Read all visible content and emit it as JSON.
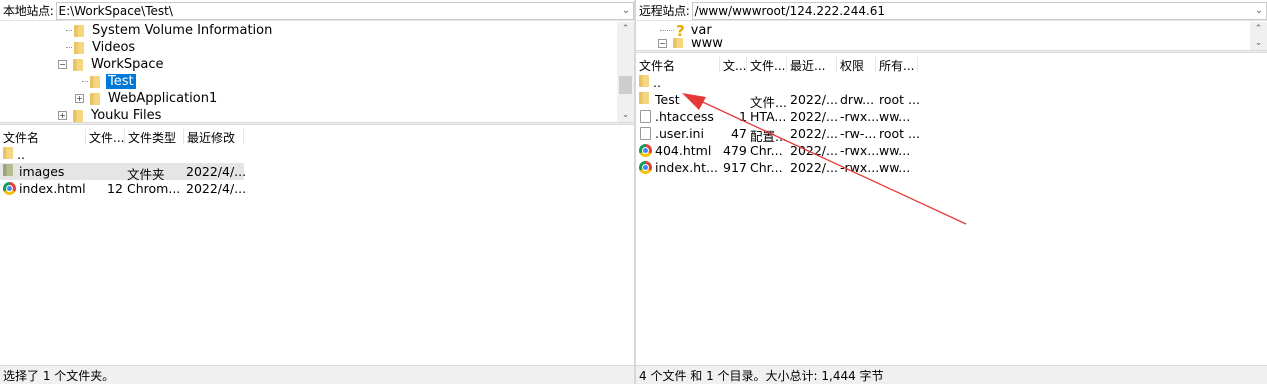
{
  "local": {
    "site_label": "本地站点:",
    "path": "E:\\WorkSpace\\Test\\",
    "tree": [
      {
        "label": "System Volume Information"
      },
      {
        "label": "Videos"
      },
      {
        "label": "WorkSpace",
        "expander": "−"
      },
      {
        "label": "Test",
        "selected": true
      },
      {
        "label": "WebApplication1",
        "expander": "+"
      },
      {
        "label": "Youku Files",
        "expander": "+"
      }
    ],
    "columns": [
      "文件名",
      "文件...",
      "文件类型",
      "最近修改"
    ],
    "files": [
      {
        "name": "..",
        "size": "",
        "type": "",
        "modified": "",
        "icon": "folder-icon"
      },
      {
        "name": "images",
        "size": "",
        "type": "文件夹",
        "modified": "2022/4/...",
        "icon": "folder-icon"
      },
      {
        "name": "index.html",
        "size": "12",
        "type": "Chrom...",
        "modified": "2022/4/...",
        "icon": "chrome-icon"
      }
    ],
    "status": "选择了 1 个文件夹。"
  },
  "remote": {
    "site_label": "远程站点:",
    "path": "/www/wwwroot/124.222.244.61",
    "tree": [
      {
        "label": "var",
        "icon": "question-icon"
      },
      {
        "label": "www",
        "expander": "−"
      }
    ],
    "columns": [
      "文件名",
      "文...",
      "文件...",
      "最近...",
      "权限",
      "所有..."
    ],
    "files": [
      {
        "name": "..",
        "size": "",
        "type": "",
        "modified": "",
        "perm": "",
        "owner": "",
        "icon": "folder-icon"
      },
      {
        "name": "Test",
        "size": "",
        "type": "文件...",
        "modified": "2022/...",
        "perm": "drw...",
        "owner": "root ...",
        "icon": "folder-icon"
      },
      {
        "name": ".htaccess",
        "size": "1",
        "type": "HTA...",
        "modified": "2022/...",
        "perm": "-rwx...",
        "owner": "ww...",
        "icon": "file-icon"
      },
      {
        "name": ".user.ini",
        "size": "47",
        "type": "配置...",
        "modified": "2022/...",
        "perm": "-rw-...",
        "owner": "root ...",
        "icon": "file-icon"
      },
      {
        "name": "404.html",
        "size": "479",
        "type": "Chr...",
        "modified": "2022/...",
        "perm": "-rwx...",
        "owner": "ww...",
        "icon": "chrome-icon"
      },
      {
        "name": "index.ht...",
        "size": "917",
        "type": "Chr...",
        "modified": "2022/...",
        "perm": "-rwx...",
        "owner": "ww...",
        "icon": "chrome-icon"
      }
    ],
    "status": "4 个文件 和 1 个目录。大小总计: 1,444 字节"
  },
  "annotation": {
    "arrow_color": "#e53935"
  }
}
